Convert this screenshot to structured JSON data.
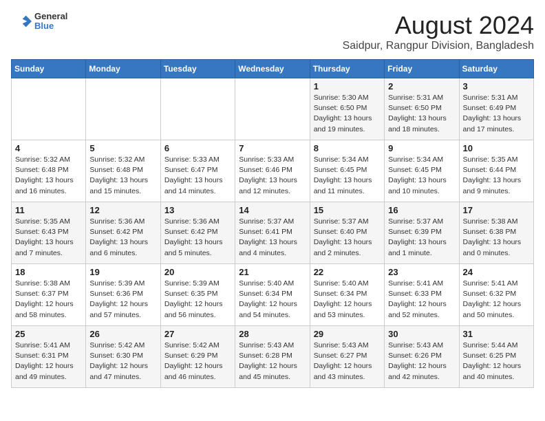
{
  "header": {
    "logo_line1": "General",
    "logo_line2": "Blue",
    "title": "August 2024",
    "subtitle": "Saidpur, Rangpur Division, Bangladesh"
  },
  "weekdays": [
    "Sunday",
    "Monday",
    "Tuesday",
    "Wednesday",
    "Thursday",
    "Friday",
    "Saturday"
  ],
  "weeks": [
    [
      {
        "day": "",
        "detail": ""
      },
      {
        "day": "",
        "detail": ""
      },
      {
        "day": "",
        "detail": ""
      },
      {
        "day": "",
        "detail": ""
      },
      {
        "day": "1",
        "detail": "Sunrise: 5:30 AM\nSunset: 6:50 PM\nDaylight: 13 hours\nand 19 minutes."
      },
      {
        "day": "2",
        "detail": "Sunrise: 5:31 AM\nSunset: 6:50 PM\nDaylight: 13 hours\nand 18 minutes."
      },
      {
        "day": "3",
        "detail": "Sunrise: 5:31 AM\nSunset: 6:49 PM\nDaylight: 13 hours\nand 17 minutes."
      }
    ],
    [
      {
        "day": "4",
        "detail": "Sunrise: 5:32 AM\nSunset: 6:48 PM\nDaylight: 13 hours\nand 16 minutes."
      },
      {
        "day": "5",
        "detail": "Sunrise: 5:32 AM\nSunset: 6:48 PM\nDaylight: 13 hours\nand 15 minutes."
      },
      {
        "day": "6",
        "detail": "Sunrise: 5:33 AM\nSunset: 6:47 PM\nDaylight: 13 hours\nand 14 minutes."
      },
      {
        "day": "7",
        "detail": "Sunrise: 5:33 AM\nSunset: 6:46 PM\nDaylight: 13 hours\nand 12 minutes."
      },
      {
        "day": "8",
        "detail": "Sunrise: 5:34 AM\nSunset: 6:45 PM\nDaylight: 13 hours\nand 11 minutes."
      },
      {
        "day": "9",
        "detail": "Sunrise: 5:34 AM\nSunset: 6:45 PM\nDaylight: 13 hours\nand 10 minutes."
      },
      {
        "day": "10",
        "detail": "Sunrise: 5:35 AM\nSunset: 6:44 PM\nDaylight: 13 hours\nand 9 minutes."
      }
    ],
    [
      {
        "day": "11",
        "detail": "Sunrise: 5:35 AM\nSunset: 6:43 PM\nDaylight: 13 hours\nand 7 minutes."
      },
      {
        "day": "12",
        "detail": "Sunrise: 5:36 AM\nSunset: 6:42 PM\nDaylight: 13 hours\nand 6 minutes."
      },
      {
        "day": "13",
        "detail": "Sunrise: 5:36 AM\nSunset: 6:42 PM\nDaylight: 13 hours\nand 5 minutes."
      },
      {
        "day": "14",
        "detail": "Sunrise: 5:37 AM\nSunset: 6:41 PM\nDaylight: 13 hours\nand 4 minutes."
      },
      {
        "day": "15",
        "detail": "Sunrise: 5:37 AM\nSunset: 6:40 PM\nDaylight: 13 hours\nand 2 minutes."
      },
      {
        "day": "16",
        "detail": "Sunrise: 5:37 AM\nSunset: 6:39 PM\nDaylight: 13 hours\nand 1 minute."
      },
      {
        "day": "17",
        "detail": "Sunrise: 5:38 AM\nSunset: 6:38 PM\nDaylight: 13 hours\nand 0 minutes."
      }
    ],
    [
      {
        "day": "18",
        "detail": "Sunrise: 5:38 AM\nSunset: 6:37 PM\nDaylight: 12 hours\nand 58 minutes."
      },
      {
        "day": "19",
        "detail": "Sunrise: 5:39 AM\nSunset: 6:36 PM\nDaylight: 12 hours\nand 57 minutes."
      },
      {
        "day": "20",
        "detail": "Sunrise: 5:39 AM\nSunset: 6:35 PM\nDaylight: 12 hours\nand 56 minutes."
      },
      {
        "day": "21",
        "detail": "Sunrise: 5:40 AM\nSunset: 6:34 PM\nDaylight: 12 hours\nand 54 minutes."
      },
      {
        "day": "22",
        "detail": "Sunrise: 5:40 AM\nSunset: 6:34 PM\nDaylight: 12 hours\nand 53 minutes."
      },
      {
        "day": "23",
        "detail": "Sunrise: 5:41 AM\nSunset: 6:33 PM\nDaylight: 12 hours\nand 52 minutes."
      },
      {
        "day": "24",
        "detail": "Sunrise: 5:41 AM\nSunset: 6:32 PM\nDaylight: 12 hours\nand 50 minutes."
      }
    ],
    [
      {
        "day": "25",
        "detail": "Sunrise: 5:41 AM\nSunset: 6:31 PM\nDaylight: 12 hours\nand 49 minutes."
      },
      {
        "day": "26",
        "detail": "Sunrise: 5:42 AM\nSunset: 6:30 PM\nDaylight: 12 hours\nand 47 minutes."
      },
      {
        "day": "27",
        "detail": "Sunrise: 5:42 AM\nSunset: 6:29 PM\nDaylight: 12 hours\nand 46 minutes."
      },
      {
        "day": "28",
        "detail": "Sunrise: 5:43 AM\nSunset: 6:28 PM\nDaylight: 12 hours\nand 45 minutes."
      },
      {
        "day": "29",
        "detail": "Sunrise: 5:43 AM\nSunset: 6:27 PM\nDaylight: 12 hours\nand 43 minutes."
      },
      {
        "day": "30",
        "detail": "Sunrise: 5:43 AM\nSunset: 6:26 PM\nDaylight: 12 hours\nand 42 minutes."
      },
      {
        "day": "31",
        "detail": "Sunrise: 5:44 AM\nSunset: 6:25 PM\nDaylight: 12 hours\nand 40 minutes."
      }
    ]
  ]
}
